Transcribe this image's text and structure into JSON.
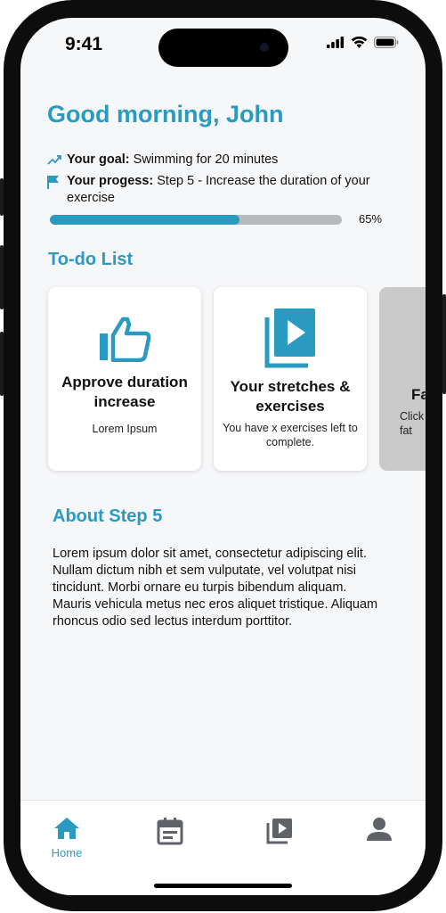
{
  "status_bar": {
    "time": "9:41"
  },
  "greeting": "Good morning, John",
  "goal": {
    "label": "Your goal:",
    "text": " Swimming for 20 minutes"
  },
  "progress": {
    "label": "Your progess:",
    "text": " Step 5 - Increase the duration of your exercise",
    "value_pct": 65,
    "display": "65%"
  },
  "todo": {
    "title": "To-do List",
    "cards": [
      {
        "icon": "thumbs-up-icon",
        "title": "Approve duration increase",
        "desc": "Lorem Ipsum"
      },
      {
        "icon": "video-library-icon",
        "title": "Your stretches & exercises",
        "desc": "You have x exercises left to complete."
      },
      {
        "icon": "",
        "title": "Fa",
        "desc": "Click fat"
      }
    ]
  },
  "about": {
    "title": "About Step 5",
    "text": "Lorem ipsum dolor sit amet, consectetur adipiscing elit. Nullam dictum nibh et sem vulputate, vel volutpat nisi tincidunt. Morbi ornare eu turpis bibendum aliquam. Mauris vehicula metus nec eros aliquet tristique. Aliquam rhoncus odio sed lectus interdum porttitor."
  },
  "tabs": [
    {
      "icon": "home-icon",
      "label": "Home",
      "active": true
    },
    {
      "icon": "calendar-icon",
      "label": "",
      "active": false
    },
    {
      "icon": "video-library-icon",
      "label": "",
      "active": false
    },
    {
      "icon": "person-icon",
      "label": "",
      "active": false
    }
  ],
  "colors": {
    "accent": "#2a9ac0",
    "inactive_icon": "#5f6368",
    "progress_track": "#b8b9bb",
    "background": "#f6f7f9"
  }
}
